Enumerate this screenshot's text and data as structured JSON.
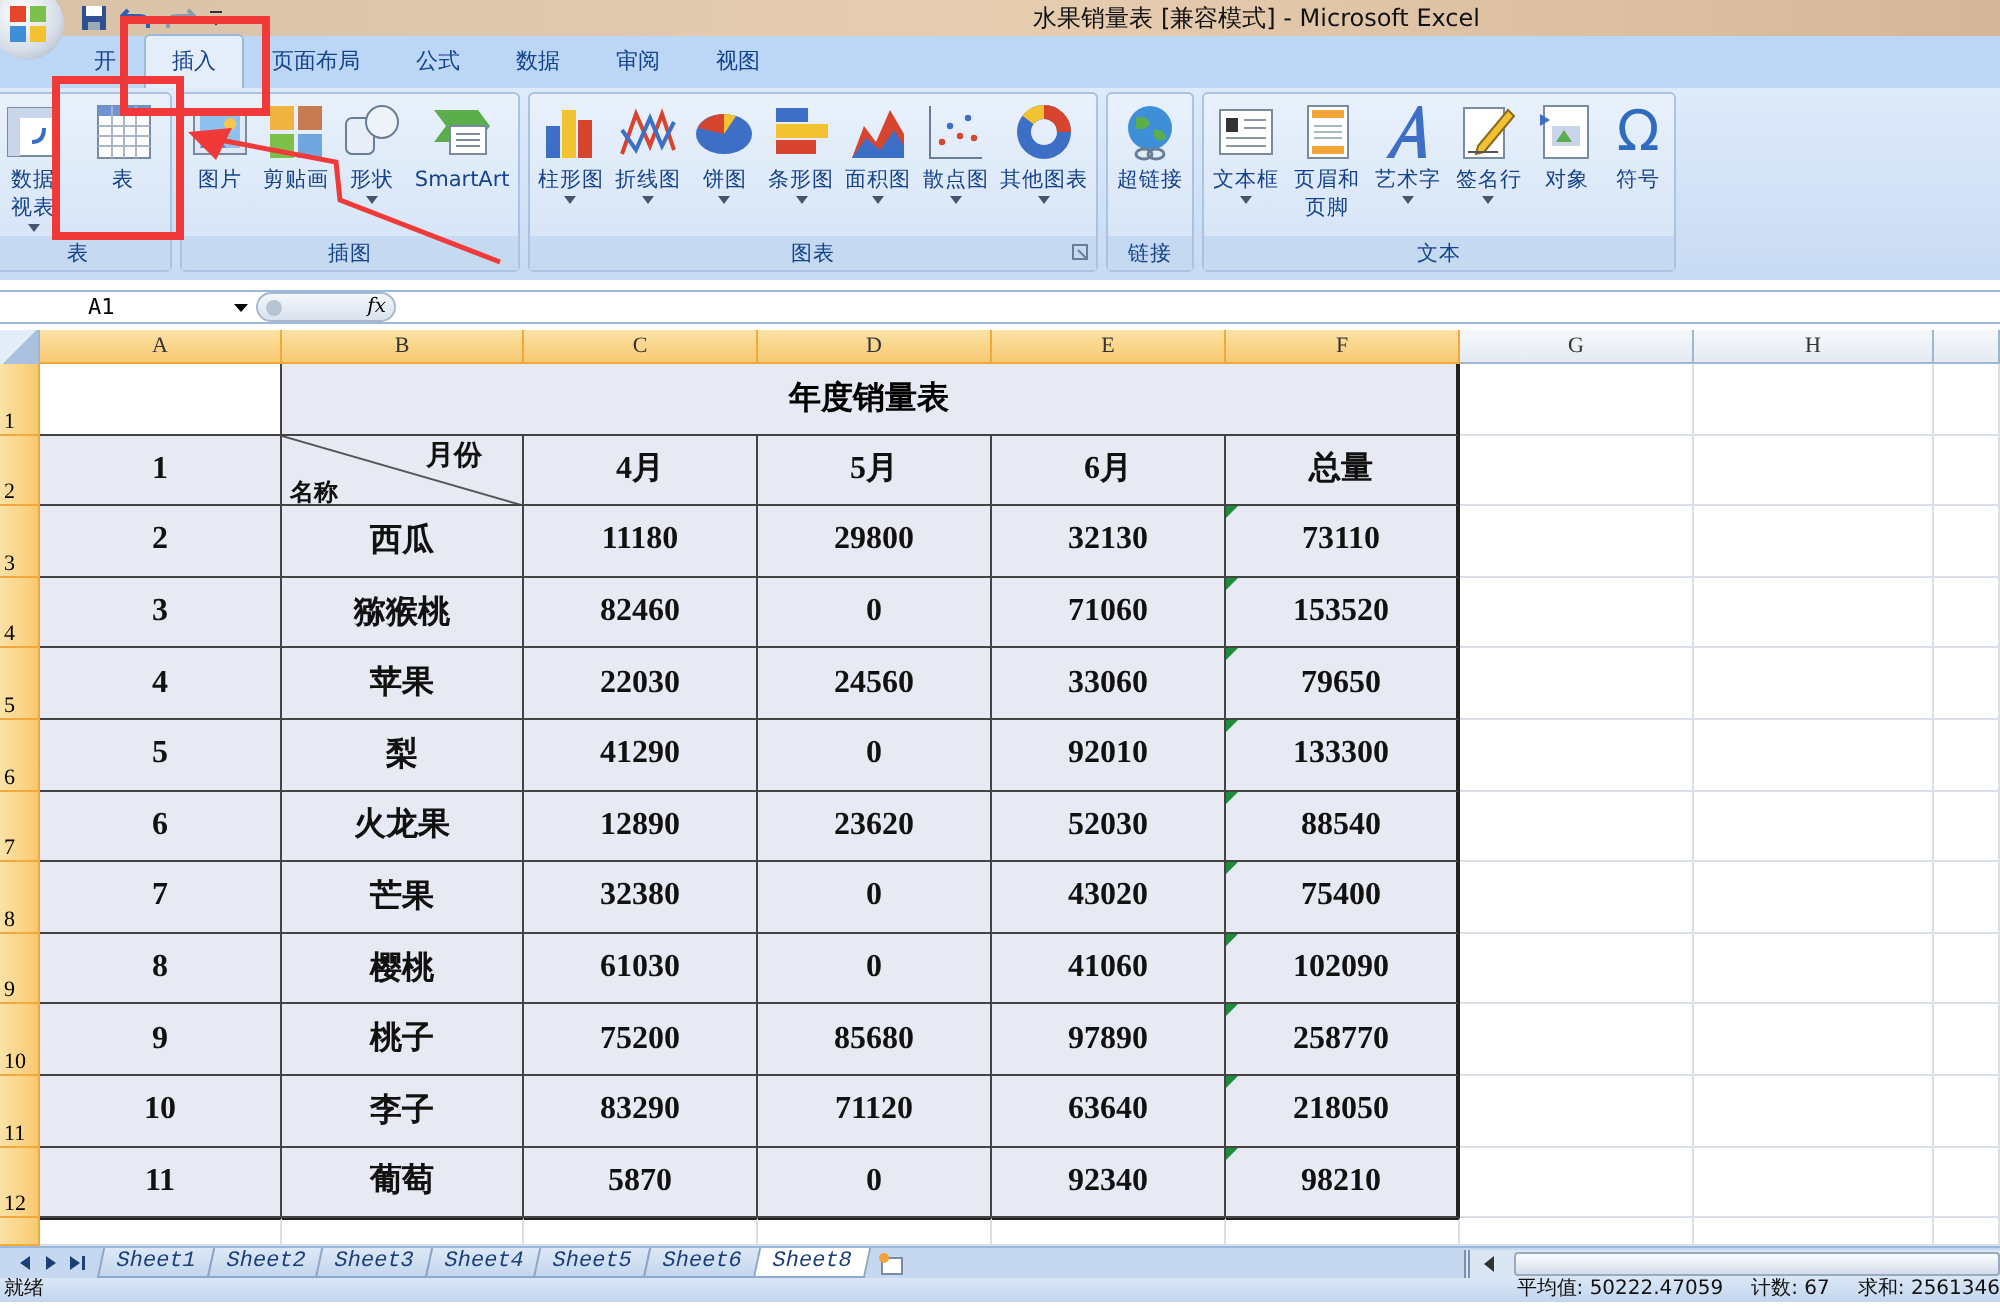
{
  "window": {
    "title": "水果销量表  [兼容模式]  -  Microsoft Excel"
  },
  "tabs": [
    {
      "label": "开",
      "selected": false
    },
    {
      "label": "插入",
      "selected": true
    },
    {
      "label": "页面布局",
      "selected": false
    },
    {
      "label": "公式",
      "selected": false
    },
    {
      "label": "数据",
      "selected": false
    },
    {
      "label": "审阅",
      "selected": false
    },
    {
      "label": "视图",
      "selected": false
    }
  ],
  "ribbon": [
    {
      "label": "表",
      "launcher": false,
      "buttons": [
        {
          "lines": [
            "数据",
            "视表"
          ],
          "dropdown": true
        },
        {
          "lines": [
            "表"
          ],
          "dropdown": false
        }
      ]
    },
    {
      "label": "插图",
      "launcher": false,
      "buttons": [
        {
          "lines": [
            "图片"
          ],
          "dropdown": false
        },
        {
          "lines": [
            "剪贴画"
          ],
          "dropdown": false
        },
        {
          "lines": [
            "形状"
          ],
          "dropdown": true
        },
        {
          "lines": [
            "SmartArt"
          ],
          "dropdown": false
        }
      ]
    },
    {
      "label": "图表",
      "launcher": true,
      "buttons": [
        {
          "lines": [
            "柱形图"
          ],
          "dropdown": true
        },
        {
          "lines": [
            "折线图"
          ],
          "dropdown": true
        },
        {
          "lines": [
            "饼图"
          ],
          "dropdown": true
        },
        {
          "lines": [
            "条形图"
          ],
          "dropdown": true
        },
        {
          "lines": [
            "面积图"
          ],
          "dropdown": true
        },
        {
          "lines": [
            "散点图"
          ],
          "dropdown": true
        },
        {
          "lines": [
            "其他图表"
          ],
          "dropdown": true
        }
      ]
    },
    {
      "label": "链接",
      "launcher": false,
      "buttons": [
        {
          "lines": [
            "超链接"
          ],
          "dropdown": false
        }
      ]
    },
    {
      "label": "文本",
      "launcher": false,
      "buttons": [
        {
          "lines": [
            "文本框"
          ],
          "dropdown": true
        },
        {
          "lines": [
            "页眉和",
            "页脚"
          ],
          "dropdown": false
        },
        {
          "lines": [
            "艺术字"
          ],
          "dropdown": true
        },
        {
          "lines": [
            "签名行"
          ],
          "dropdown": true
        },
        {
          "lines": [
            "对象"
          ],
          "dropdown": false
        },
        {
          "lines": [
            "符号"
          ],
          "dropdown": false,
          "glyph": "Ω"
        }
      ]
    }
  ],
  "formula_bar": {
    "name_box": "A1",
    "function_label": "fx"
  },
  "columns": [
    {
      "label": "A",
      "selected": true
    },
    {
      "label": "B",
      "selected": true
    },
    {
      "label": "C",
      "selected": true
    },
    {
      "label": "D",
      "selected": true
    },
    {
      "label": "E",
      "selected": true
    },
    {
      "label": "F",
      "selected": true
    },
    {
      "label": "G",
      "selected": false
    },
    {
      "label": "H",
      "selected": false
    }
  ],
  "table": {
    "title_row": "1",
    "title": "年度销量表",
    "header": {
      "row": "2",
      "index": "1",
      "diagonal_top": "月份",
      "diagonal_bottom": "名称",
      "months": [
        "4月",
        "5月",
        "6月"
      ],
      "total": "总量"
    },
    "rows": [
      {
        "row": "3",
        "index": "2",
        "name": "西瓜",
        "values": [
          "11180",
          "29800",
          "32130"
        ],
        "total": "73110",
        "flagged": true
      },
      {
        "row": "4",
        "index": "3",
        "name": "猕猴桃",
        "values": [
          "82460",
          "0",
          "71060"
        ],
        "total": "153520",
        "flagged": true
      },
      {
        "row": "5",
        "index": "4",
        "name": "苹果",
        "values": [
          "22030",
          "24560",
          "33060"
        ],
        "total": "79650",
        "flagged": true
      },
      {
        "row": "6",
        "index": "5",
        "name": "梨",
        "values": [
          "41290",
          "0",
          "92010"
        ],
        "total": "133300",
        "flagged": true
      },
      {
        "row": "7",
        "index": "6",
        "name": "火龙果",
        "values": [
          "12890",
          "23620",
          "52030"
        ],
        "total": "88540",
        "flagged": true
      },
      {
        "row": "8",
        "index": "7",
        "name": "芒果",
        "values": [
          "32380",
          "0",
          "43020"
        ],
        "total": "75400",
        "flagged": true
      },
      {
        "row": "9",
        "index": "8",
        "name": "樱桃",
        "values": [
          "61030",
          "0",
          "41060"
        ],
        "total": "102090",
        "flagged": true
      },
      {
        "row": "10",
        "index": "9",
        "name": "桃子",
        "values": [
          "75200",
          "85680",
          "97890"
        ],
        "total": "258770",
        "flagged": true
      },
      {
        "row": "11",
        "index": "10",
        "name": "李子",
        "values": [
          "83290",
          "71120",
          "63640"
        ],
        "total": "218050",
        "flagged": true
      },
      {
        "row": "12",
        "index": "11",
        "name": "葡萄",
        "values": [
          "5870",
          "0",
          "92340"
        ],
        "total": "98210",
        "flagged": true
      }
    ]
  },
  "sheet_tabs": [
    {
      "label": "Sheet1",
      "selected": false
    },
    {
      "label": "Sheet2",
      "selected": false
    },
    {
      "label": "Sheet3",
      "selected": false
    },
    {
      "label": "Sheet4",
      "selected": false
    },
    {
      "label": "Sheet5",
      "selected": false
    },
    {
      "label": "Sheet6",
      "selected": false
    },
    {
      "label": "Sheet8",
      "selected": true
    }
  ],
  "status_bar": {
    "state": "就绪",
    "average": "平均值: 50222.47059",
    "count": "计数: 67",
    "sum": "求和: 2561346"
  }
}
